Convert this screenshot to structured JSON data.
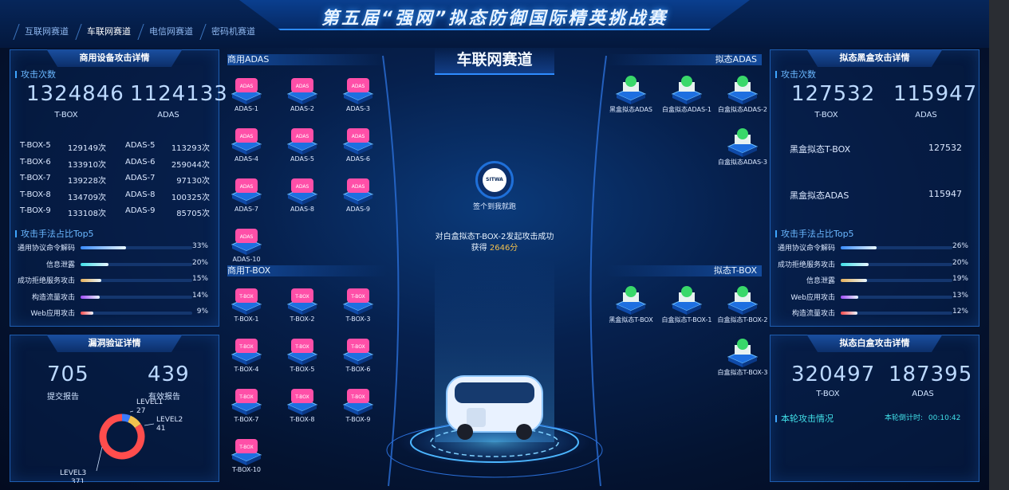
{
  "header": {
    "title": "第五届“强网”拟态防御国际精英挑战赛",
    "tabs": [
      "互联网赛道",
      "车联网赛道",
      "电信网赛道",
      "密码机赛道"
    ],
    "active_tab": 1
  },
  "center": {
    "track_title": "车联网赛道",
    "logo_text": "SITWA",
    "signin_caption": "签个到我就跑",
    "event_text": "对白盒拟态T-BOX-2发起攻击成功",
    "score_prefix": "获得",
    "score_value": "2646分"
  },
  "commercial_panel": {
    "title": "商用设备攻击详情",
    "attack_count_label": "攻击次数",
    "tbox_total": "1324846",
    "tbox_label": "T-BOX",
    "adas_total": "1124133",
    "adas_label": "ADAS",
    "rows": [
      {
        "a_name": "T-BOX-5",
        "a_val": "129149次",
        "b_name": "ADAS-5",
        "b_val": "113293次"
      },
      {
        "a_name": "T-BOX-6",
        "a_val": "133910次",
        "b_name": "ADAS-6",
        "b_val": "259044次"
      },
      {
        "a_name": "T-BOX-7",
        "a_val": "139228次",
        "b_name": "ADAS-7",
        "b_val": "97130次"
      },
      {
        "a_name": "T-BOX-8",
        "a_val": "134709次",
        "b_name": "ADAS-8",
        "b_val": "100325次"
      },
      {
        "a_name": "T-BOX-9",
        "a_val": "133108次",
        "b_name": "ADAS-9",
        "b_val": "85705次"
      }
    ],
    "method_label": "攻击手法占比Top5",
    "methods": [
      {
        "name": "通用协议命令解码",
        "pct": "33%",
        "frac": 0.33,
        "color": "#3a8cff"
      },
      {
        "name": "信息泄露",
        "pct": "20%",
        "frac": 0.2,
        "color": "#41e0e8"
      },
      {
        "name": "成功拒绝服务攻击",
        "pct": "15%",
        "frac": 0.15,
        "color": "#e6b15a"
      },
      {
        "name": "构造流量攻击",
        "pct": "14%",
        "frac": 0.14,
        "color": "#a24dff"
      },
      {
        "name": "Web应用攻击",
        "pct": "9%",
        "frac": 0.09,
        "color": "#ff4a4a"
      }
    ]
  },
  "vuln_panel": {
    "title": "漏洞验证详情",
    "submitted": "705",
    "submitted_label": "提交报告",
    "valid": "439",
    "valid_label": "有效报告",
    "levels": [
      {
        "name": "LEVEL1",
        "value": "27",
        "num": 27,
        "color": "#3a7bff"
      },
      {
        "name": "LEVEL2",
        "value": "41",
        "num": 41,
        "color": "#f2c14e"
      },
      {
        "name": "LEVEL3",
        "value": "371",
        "num": 371,
        "color": "#ff4d4d"
      }
    ]
  },
  "commercial_adas": {
    "heading": "商用ADAS",
    "items": [
      "ADAS-1",
      "ADAS-2",
      "ADAS-3",
      "ADAS-4",
      "ADAS-5",
      "ADAS-6",
      "ADAS-7",
      "ADAS-8",
      "ADAS-9",
      "ADAS-10"
    ],
    "badge": "ADAS"
  },
  "commercial_tbox": {
    "heading": "商用T-BOX",
    "items": [
      "T-BOX-1",
      "T-BOX-2",
      "T-BOX-3",
      "T-BOX-4",
      "T-BOX-5",
      "T-BOX-6",
      "T-BOX-7",
      "T-BOX-8",
      "T-BOX-9",
      "T-BOX-10"
    ],
    "badge": "T-BOX"
  },
  "mimic_adas": {
    "heading": "拟态ADAS",
    "items": [
      "黑盒拟态ADAS",
      "白盒拟态ADAS-1",
      "白盒拟态ADAS-2",
      "白盒拟态ADAS-3"
    ]
  },
  "mimic_tbox": {
    "heading": "拟态T-BOX",
    "items": [
      "黑盒拟态T-BOX",
      "白盒拟态T-BOX-1",
      "白盒拟态T-BOX-2",
      "白盒拟态T-BOX-3"
    ]
  },
  "blackbox_panel": {
    "title": "拟态黑盒攻击详情",
    "attack_count_label": "攻击次数",
    "tbox_total": "127532",
    "tbox_label": "T-BOX",
    "adas_total": "115947",
    "adas_label": "ADAS",
    "rows": [
      {
        "name": "黑盒拟态T-BOX",
        "value": "127532"
      },
      {
        "name": "黑盒拟态ADAS",
        "value": "115947"
      }
    ],
    "method_label": "攻击手法占比Top5",
    "methods": [
      {
        "name": "通用协议命令解码",
        "pct": "26%",
        "frac": 0.26,
        "color": "#3a8cff"
      },
      {
        "name": "成功拒绝服务攻击",
        "pct": "20%",
        "frac": 0.2,
        "color": "#41e0e8"
      },
      {
        "name": "信息泄露",
        "pct": "19%",
        "frac": 0.19,
        "color": "#e6b15a"
      },
      {
        "name": "Web应用攻击",
        "pct": "13%",
        "frac": 0.13,
        "color": "#a24dff"
      },
      {
        "name": "构造流量攻击",
        "pct": "12%",
        "frac": 0.12,
        "color": "#ff4a4a"
      }
    ]
  },
  "whitebox_panel": {
    "title": "拟态白盒攻击详情",
    "tbox_total": "320497",
    "tbox_label": "T-BOX",
    "adas_total": "187395",
    "adas_label": "ADAS",
    "round_label": "本轮攻击情况",
    "countdown_label": "本轮倒计时:",
    "countdown_value": "00:10:42"
  },
  "colors": {
    "accent": "#2f8cff",
    "score": "#f2c14e",
    "commercial": "#ff4fa8",
    "mimic": "#39d86a"
  }
}
